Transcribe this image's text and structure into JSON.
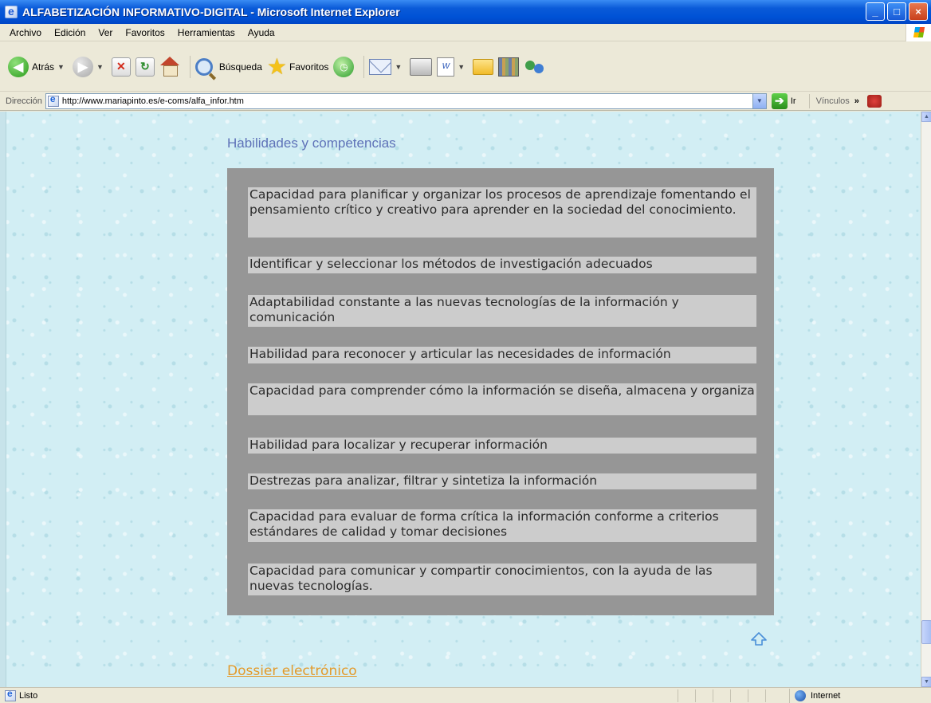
{
  "window": {
    "title": "ALFABETIZACIÓN INFORMATIVO-DIGITAL - Microsoft Internet Explorer",
    "controls": [
      "minimize",
      "maximize",
      "close"
    ]
  },
  "menu": [
    "Archivo",
    "Edición",
    "Ver",
    "Favoritos",
    "Herramientas",
    "Ayuda"
  ],
  "toolbar": {
    "back_label": "Atrás",
    "search_label": "Búsqueda",
    "favorites_label": "Favoritos"
  },
  "address": {
    "label": "Dirección",
    "url": "http://www.mariapinto.es/e-coms/alfa_infor.htm",
    "go_label": "Ir",
    "links_label": "Vínculos"
  },
  "page": {
    "heading": "Habilidades y competencias",
    "items": [
      "Capacidad para planificar y organizar los procesos de aprendizaje fomentando el pensamiento crítico y creativo para aprender en la sociedad del conocimiento.",
      "Identificar y seleccionar los métodos de investigación adecuados",
      "Adaptabilidad constante a las nuevas tecnologías de la información y comunicación",
      "Habilidad para reconocer y articular las necesidades de información",
      "Capacidad para comprender cómo la información se diseña, almacena y organiza",
      "Habilidad para localizar y recuperar información",
      "Destrezas para analizar, filtrar y sintetiza la información",
      "Capacidad para evaluar de forma crítica la información conforme a criterios estándares de calidad y tomar decisiones",
      "Capacidad para comunicar y compartir conocimientos, con la ayuda de las nuevas tecnologías."
    ],
    "link": "Dossier electrónico"
  },
  "status": {
    "text": "Listo",
    "zone": "Internet"
  },
  "colors": {
    "heading": "#5e72b8",
    "panel": "#969696",
    "item_bg": "#cccccc",
    "link": "#e39a2a"
  }
}
